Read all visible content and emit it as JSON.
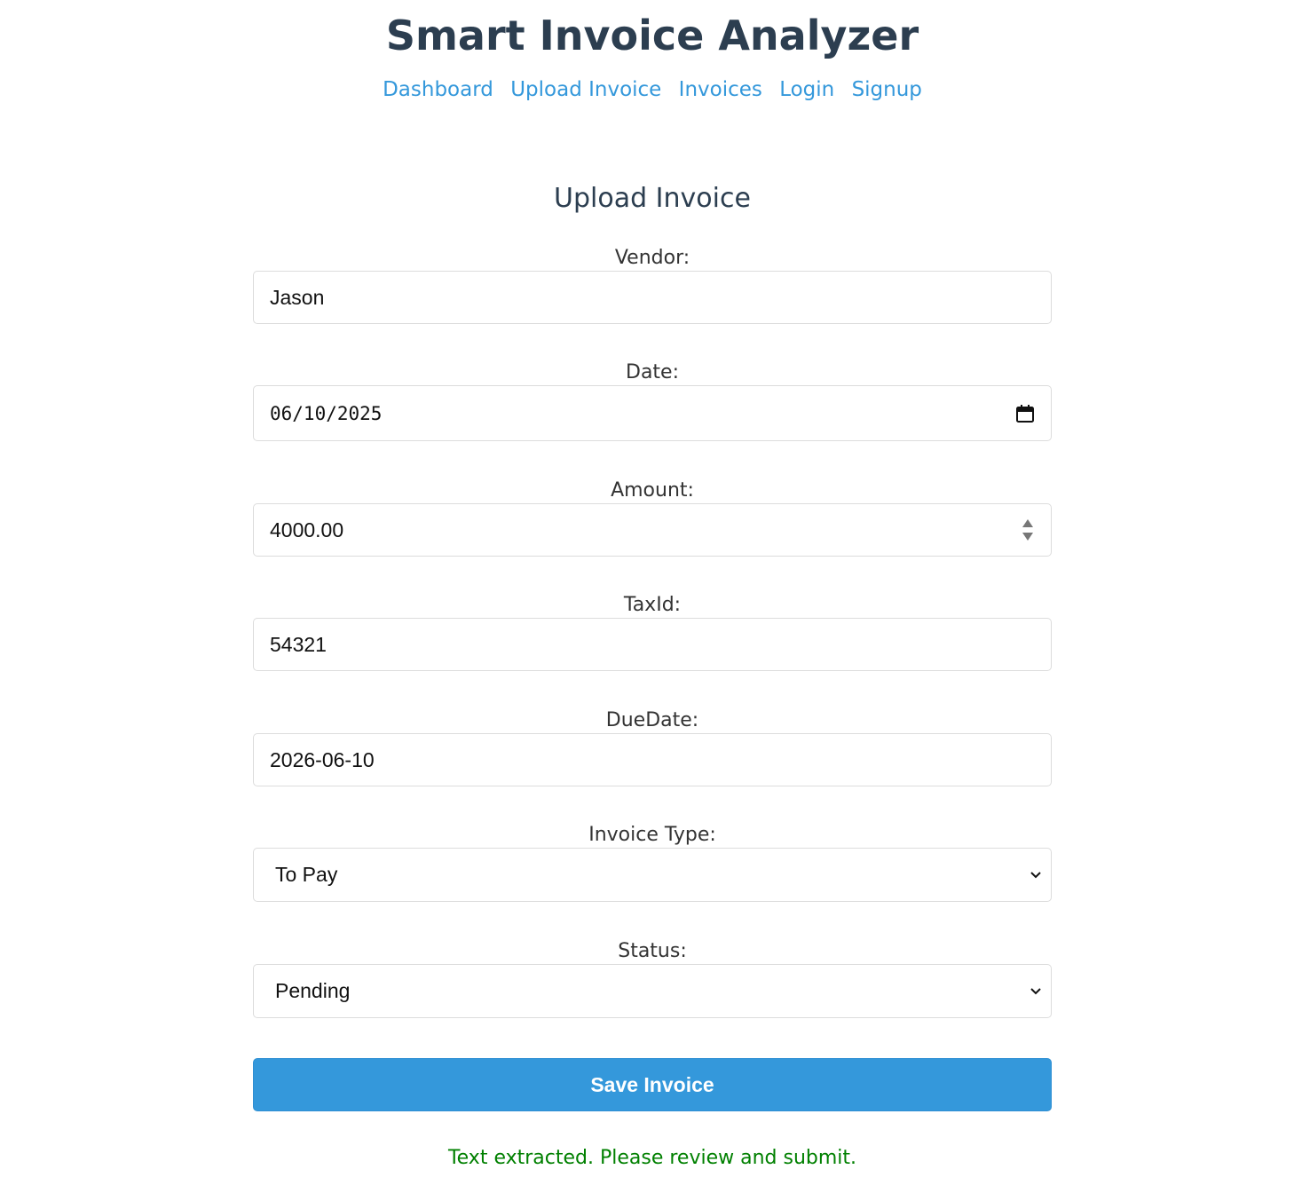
{
  "app": {
    "title": "Smart Invoice Analyzer"
  },
  "nav": {
    "items": [
      {
        "label": "Dashboard"
      },
      {
        "label": "Upload Invoice"
      },
      {
        "label": "Invoices"
      },
      {
        "label": "Login"
      },
      {
        "label": "Signup"
      }
    ],
    "link_color": "#3498db"
  },
  "form": {
    "title": "Upload Invoice",
    "vendor": {
      "label": "Vendor:",
      "value": "Jason"
    },
    "date": {
      "label": "Date:",
      "value": "06/10/2025",
      "icon": "calendar-icon"
    },
    "amount": {
      "label": "Amount:",
      "value": "4000.00",
      "icon": "spinner-arrows-icon"
    },
    "tax_id": {
      "label": "TaxId:",
      "value": "54321"
    },
    "due_date": {
      "label": "DueDate:",
      "value": "2026-06-10"
    },
    "invoice_type": {
      "label": "Invoice Type:",
      "value": "To Pay",
      "icon": "chevron-down-icon"
    },
    "status": {
      "label": "Status:",
      "value": "Pending",
      "icon": "chevron-down-icon"
    },
    "save_label": "Save Invoice",
    "button_color": "#3498db"
  },
  "message": {
    "text": "Text extracted. Please review and submit.",
    "color": "#008000"
  }
}
